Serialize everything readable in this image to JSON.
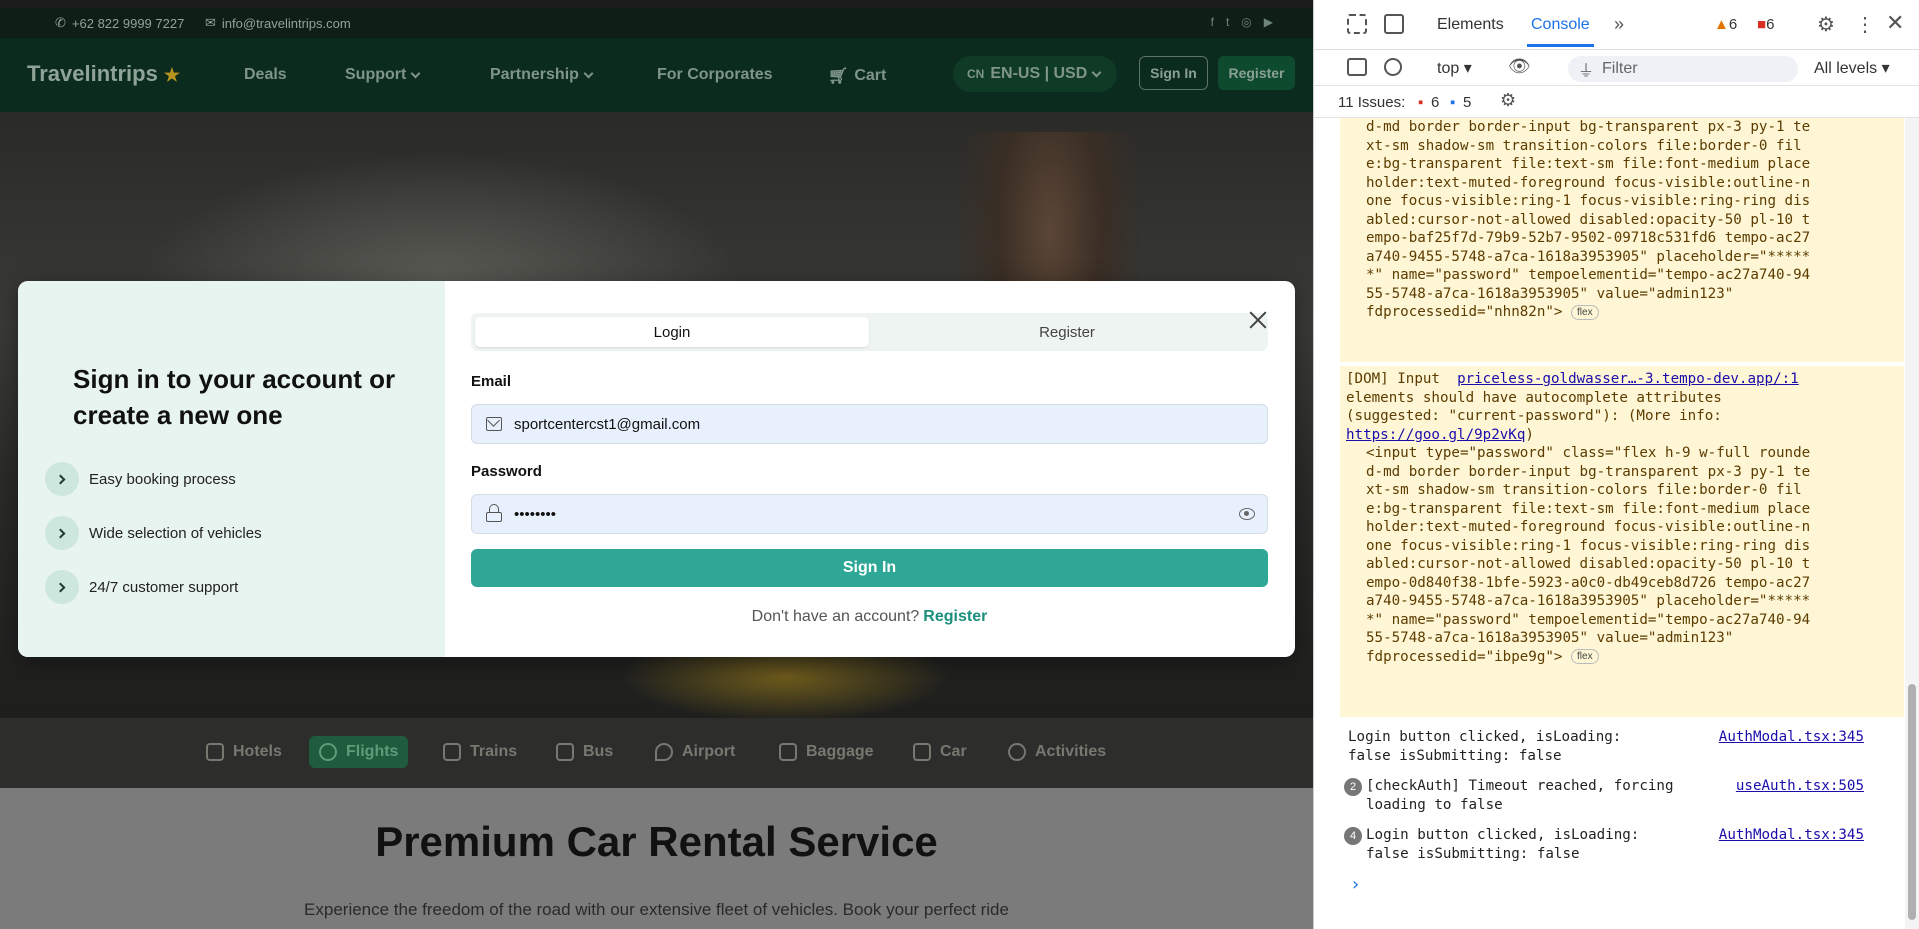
{
  "topbar": {
    "phone": "+62 822 9999 7227",
    "email": "info@travelintrips.com"
  },
  "nav": {
    "brand": "Travelintrips",
    "links": [
      "Deals",
      "Support",
      "Partnership",
      "For Corporates",
      "Cart"
    ],
    "locale_flag": "CN",
    "locale": "EN-US | USD",
    "sign_in": "Sign In",
    "register": "Register"
  },
  "services": [
    "Hotels",
    "Flights",
    "Trains",
    "Bus",
    "Airport",
    "Baggage",
    "Car",
    "Activities"
  ],
  "below": {
    "heading": "Premium Car Rental Service",
    "subtext": "Experience the freedom of the road with our extensive fleet of vehicles. Book your perfect ride"
  },
  "modal": {
    "heading": "Sign in to your account or create a new one",
    "features": [
      "Easy booking process",
      "Wide selection of vehicles",
      "24/7 customer support"
    ],
    "tabs": [
      "Login",
      "Register"
    ],
    "email_label": "Email",
    "email_value": "sportcentercst1@gmail.com",
    "password_label": "Password",
    "password_value": "••••••••",
    "submit": "Sign In",
    "footer_text": "Don't have an account?",
    "footer_link": "Register"
  },
  "devtools": {
    "tabs": [
      "Elements",
      "Console"
    ],
    "warning_count": "6",
    "error_count": "6",
    "context": "top",
    "filter_placeholder": "Filter",
    "levels": "All levels",
    "issues_label": "11 Issues:",
    "issues_errors": "6",
    "issues_info": "5",
    "warn1_lines": [
      "d-md border border-input bg-transparent px-3 py-1 te",
      "xt-sm shadow-sm transition-colors file:border-0 fil",
      "e:bg-transparent file:text-sm file:font-medium place",
      "holder:text-muted-foreground focus-visible:outline-n",
      "one focus-visible:ring-1 focus-visible:ring-ring dis",
      "abled:cursor-not-allowed disabled:opacity-50 pl-10 t",
      "empo-baf25f7d-79b9-52b7-9502-09718c531fd6 tempo-ac27",
      "a740-9455-5748-a7ca-1618a3953905\" placeholder=\"*****",
      "*\" name=\"password\" tempoelementid=\"tempo-ac27a740-94",
      "55-5748-a7ca-1618a3953905\" value=\"admin123\"",
      "fdprocessedid=\"nhn82n\">"
    ],
    "warn2_header": "[DOM] Input",
    "warn2_link": "priceless-goldwasser…-3.tempo-dev.app/:1",
    "warn2_msg_lines": [
      "elements should have autocomplete attributes",
      "(suggested: \"current-password\"): (More info:"
    ],
    "warn2_url": "https://goo.gl/9p2vKq",
    "warn2_code": [
      "<input type=\"password\" class=\"flex h-9 w-full rounde",
      "d-md border border-input bg-transparent px-3 py-1 te",
      "xt-sm shadow-sm transition-colors file:border-0 fil",
      "e:bg-transparent file:text-sm file:font-medium place",
      "holder:text-muted-foreground focus-visible:outline-n",
      "one focus-visible:ring-1 focus-visible:ring-ring dis",
      "abled:cursor-not-allowed disabled:opacity-50 pl-10 t",
      "empo-0d840f38-1bfe-5923-a0c0-db49ceb8d726 tempo-ac27",
      "a740-9455-5748-a7ca-1618a3953905\" placeholder=\"*****",
      "*\" name=\"password\" tempoelementid=\"tempo-ac27a740-94",
      "55-5748-a7ca-1618a3953905\" value=\"admin123\"",
      "fdprocessedid=\"ibpe9g\">"
    ],
    "flex_badge": "flex",
    "logs": [
      {
        "count": "",
        "lines": [
          "Login button clicked, isLoading:",
          "false isSubmitting: false"
        ],
        "source": "AuthModal.tsx:345"
      },
      {
        "count": "2",
        "lines": [
          "[checkAuth] Timeout reached, forcing",
          "loading to false"
        ],
        "source": "useAuth.tsx:505"
      },
      {
        "count": "4",
        "lines": [
          "Login button clicked, isLoading:",
          "false isSubmitting: false"
        ],
        "source": "AuthModal.tsx:345"
      }
    ],
    "prompt": "›"
  },
  "colors": {
    "accent": "#2ea797",
    "devtools_blue": "#1a73e8",
    "warning_bg": "#fef6d5"
  }
}
